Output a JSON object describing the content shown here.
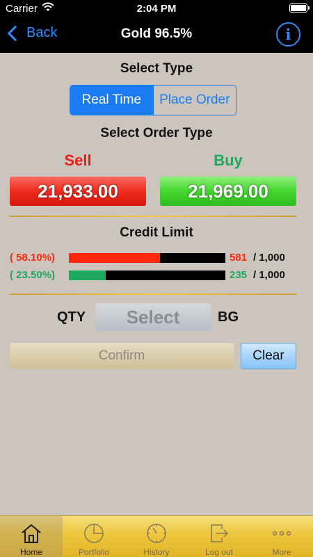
{
  "status_bar": {
    "carrier": "Carrier",
    "time": "2:04 PM"
  },
  "nav": {
    "back_label": "Back",
    "title": "Gold 96.5%"
  },
  "select_type": {
    "title": "Select Type",
    "options": [
      "Real Time",
      "Place Order"
    ],
    "selected": "Real Time"
  },
  "order_type": {
    "title": "Select Order Type",
    "sell_label": "Sell",
    "buy_label": "Buy",
    "sell_price": "21,933.00",
    "buy_price": "21,969.00"
  },
  "credit": {
    "title": "Credit Limit",
    "rows": [
      {
        "percent_label": "( 58.10%)",
        "used": "581",
        "total": "/ 1,000",
        "fill_fraction": 0.581,
        "color": "#ff2a0c"
      },
      {
        "percent_label": "( 23.50%)",
        "used": "235",
        "total": "/ 1,000",
        "fill_fraction": 0.235,
        "color": "#1fa860"
      }
    ]
  },
  "quantity": {
    "label": "QTY",
    "select_text": "Select",
    "unit": "BG"
  },
  "actions": {
    "confirm": "Confirm",
    "clear": "Clear"
  },
  "tabs": [
    {
      "label": "Home",
      "icon": "home-icon",
      "active": true
    },
    {
      "label": "Portfolio",
      "icon": "pie-chart-icon",
      "active": false
    },
    {
      "label": "History",
      "icon": "clock-icon",
      "active": false
    },
    {
      "label": "Log out",
      "icon": "logout-icon",
      "active": false
    },
    {
      "label": "More",
      "icon": "more-icon",
      "active": false
    }
  ],
  "colors": {
    "sell": "#ee2d1f",
    "buy": "#1fa860",
    "accent": "#1a7cf4",
    "tab_bar": "#ecc53c"
  }
}
